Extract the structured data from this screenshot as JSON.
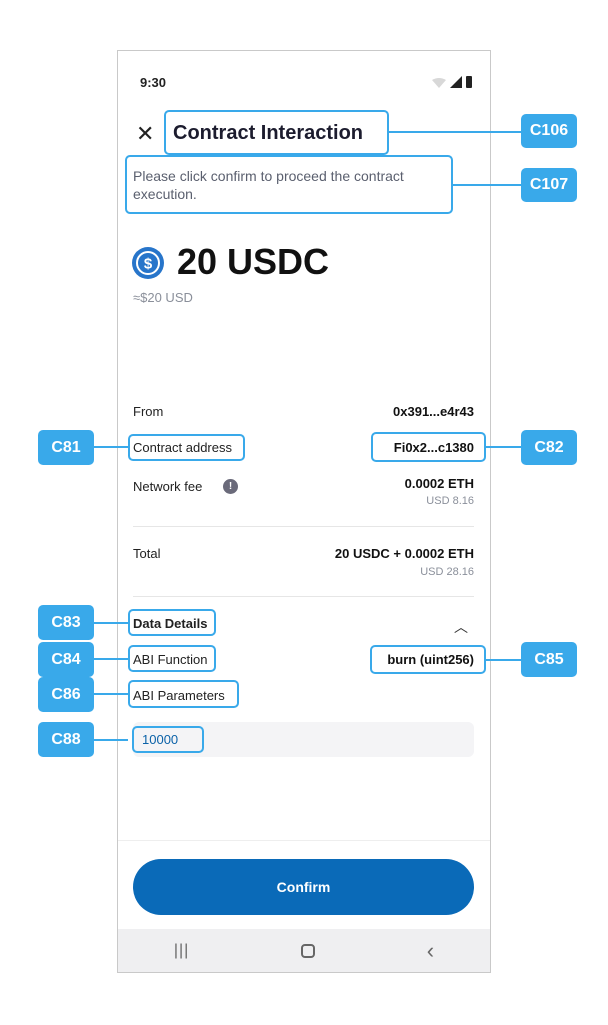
{
  "status_bar": {
    "time": "9:30"
  },
  "header": {
    "title": "Contract Interaction",
    "close_icon": "close-icon"
  },
  "subtitle": "Please click confirm to proceed the contract execution.",
  "amount": {
    "value": "20 USDC",
    "fiat": "≈$20 USD",
    "token_icon": "usdc-icon"
  },
  "rows": {
    "from": {
      "label": "From",
      "value": "0x391...e4r43"
    },
    "contract": {
      "label": "Contract address",
      "value": "Fi0x2...c1380"
    },
    "fee": {
      "label": "Network fee",
      "value": "0.0002 ETH",
      "sub": "USD 8.16"
    },
    "total": {
      "label": "Total",
      "value": "20 USDC + 0.0002 ETH",
      "sub": "USD 28.16"
    }
  },
  "data_details": {
    "title": "Data Details",
    "abi_function_label": "ABI Function",
    "abi_function_value": "burn (uint256)",
    "abi_parameters_label": "ABI Parameters",
    "parameter_value": "10000"
  },
  "confirm_label": "Confirm",
  "annotations": {
    "c106": "C106",
    "c107": "C107",
    "c81": "C81",
    "c82": "C82",
    "c83": "C83",
    "c84": "C84",
    "c85": "C85",
    "c86": "C86",
    "c88": "C88"
  },
  "colors": {
    "accent": "#0a6ab8",
    "annotation": "#39a9ea",
    "usdc": "#2775ca"
  }
}
